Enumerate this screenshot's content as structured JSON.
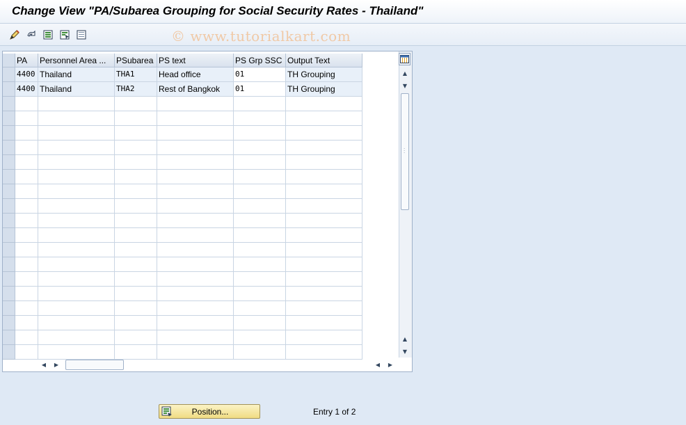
{
  "window": {
    "title": "Change View \"PA/Subarea Grouping for Social Security Rates - Thailand\"",
    "watermark": "© www.tutorialkart.com"
  },
  "toolbar": {
    "icons": [
      "edit-pencil-icon",
      "undo-icon",
      "select-all-icon",
      "select-block-icon",
      "deselect-all-icon"
    ]
  },
  "table": {
    "columns": [
      "PA",
      "Personnel Area ...",
      "PSubarea",
      "PS text",
      "PS Grp SSC",
      "Output Text"
    ],
    "rows": [
      {
        "pa": "4400",
        "personnel_area": "Thailand",
        "psubarea": "THA1",
        "ps_text": "Head office",
        "ps_grp_ssc": "01",
        "output_text": "TH Grouping"
      },
      {
        "pa": "4400",
        "personnel_area": "Thailand",
        "psubarea": "THA2",
        "ps_text": "Rest of Bangkok",
        "ps_grp_ssc": "01",
        "output_text": "TH Grouping"
      }
    ]
  },
  "footer": {
    "position_label": "Position...",
    "entry_text": "Entry 1 of 2"
  },
  "colors": {
    "background": "#dfe9f5",
    "filled_row": "#e8f0f9",
    "position_button": "#f0dc83"
  }
}
